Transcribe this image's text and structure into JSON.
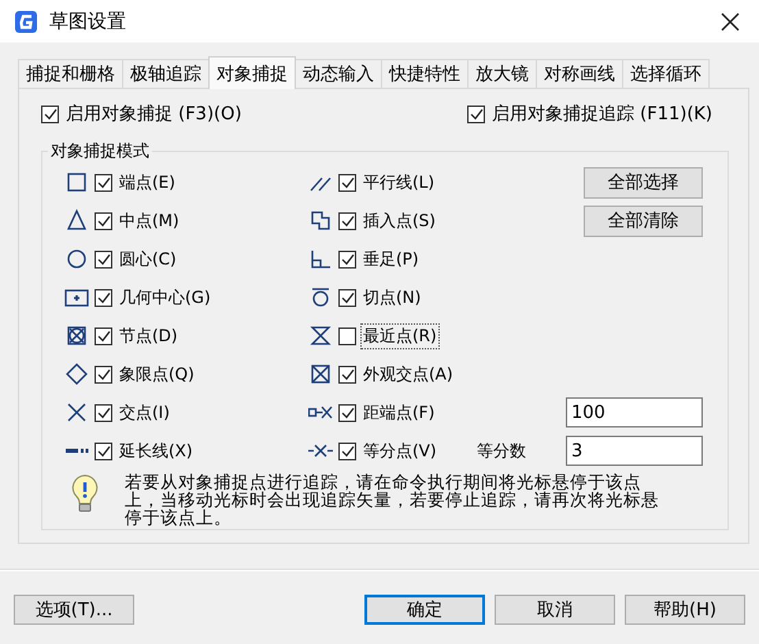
{
  "window": {
    "title": "草图设置"
  },
  "tabs": [
    {
      "label": "捕捉和栅格",
      "selected": false
    },
    {
      "label": "极轴追踪",
      "selected": false
    },
    {
      "label": "对象捕捉",
      "selected": true
    },
    {
      "label": "动态输入",
      "selected": false
    },
    {
      "label": "快捷特性",
      "selected": false
    },
    {
      "label": "放大镜",
      "selected": false
    },
    {
      "label": "对称画线",
      "selected": false
    },
    {
      "label": "选择循环",
      "selected": false
    }
  ],
  "enable_options": [
    {
      "label": "启用对象捕捉 (F3)(O)",
      "checked": true
    },
    {
      "label": "启用对象捕捉追踪 (F11)(K)",
      "checked": true
    }
  ],
  "group_title": "对象捕捉模式",
  "modes_left": [
    {
      "label": "端点(E)",
      "checked": true
    },
    {
      "label": "中点(M)",
      "checked": true
    },
    {
      "label": "圆心(C)",
      "checked": true
    },
    {
      "label": "几何中心(G)",
      "checked": true
    },
    {
      "label": "节点(D)",
      "checked": true
    },
    {
      "label": "象限点(Q)",
      "checked": true
    },
    {
      "label": "交点(I)",
      "checked": true
    },
    {
      "label": "延长线(X)",
      "checked": true
    }
  ],
  "modes_right": [
    {
      "label": "平行线(L)",
      "checked": true,
      "focused": false
    },
    {
      "label": "插入点(S)",
      "checked": true,
      "focused": false
    },
    {
      "label": "垂足(P)",
      "checked": true,
      "focused": false
    },
    {
      "label": "切点(N)",
      "checked": true,
      "focused": false
    },
    {
      "label": "最近点(R)",
      "checked": false,
      "focused": true
    },
    {
      "label": "外观交点(A)",
      "checked": true,
      "focused": false
    },
    {
      "label": "距端点(F)",
      "checked": true,
      "focused": false
    },
    {
      "label": "等分点(V)",
      "checked": true,
      "focused": false
    }
  ],
  "side_buttons": [
    "全部选择",
    "全部清除"
  ],
  "distance_field": {
    "value": "100"
  },
  "divisions": {
    "label": "等分数",
    "value": "3"
  },
  "tip": "若要从对象捕捉点进行追踪，请在命令执行期间将光标悬停于该点上，当移动光标时会出现追踪矢量，若要停止追踪，请再次将光标悬停于该点上。",
  "footer_buttons": [
    {
      "label": "选项(T)...",
      "kind": "options",
      "default": false
    },
    {
      "label": "确定",
      "kind": "action",
      "default": true
    },
    {
      "label": "取消",
      "kind": "action",
      "default": false
    },
    {
      "label": "帮助(H)",
      "kind": "action",
      "default": false
    }
  ]
}
